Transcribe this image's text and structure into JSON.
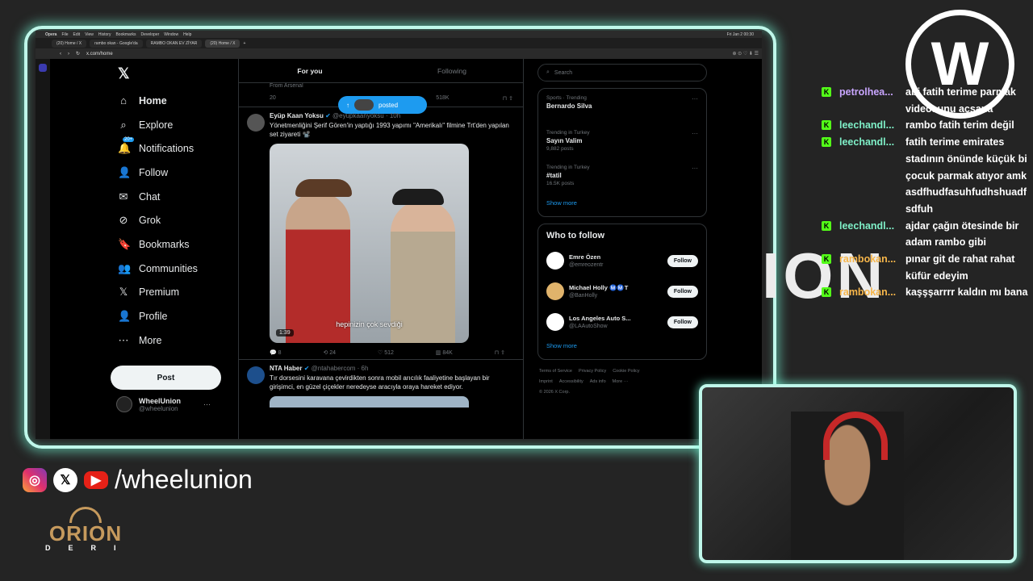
{
  "mac_menu": {
    "app": "Opera",
    "items": [
      "File",
      "Edit",
      "View",
      "History",
      "Bookmarks",
      "Developer",
      "Window",
      "Help"
    ],
    "clock": "Fri Jan 2 00:30"
  },
  "browser": {
    "tabs": [
      "(20) Home / X",
      "rambo okan - Google'da",
      "RAMBO OKAN EV ZİYAR",
      "(20) Home / X"
    ],
    "url": "x.com/home"
  },
  "nav": {
    "home": "Home",
    "explore": "Explore",
    "notifications": "Notifications",
    "notif_badge": "20+",
    "follow": "Follow",
    "chat": "Chat",
    "grok": "Grok",
    "bookmarks": "Bookmarks",
    "communities": "Communities",
    "premium": "Premium",
    "profile": "Profile",
    "more": "More",
    "post": "Post"
  },
  "account": {
    "name": "WheelUnion",
    "handle": "@wheelunion"
  },
  "feed": {
    "tab_for_you": "For you",
    "tab_following": "Following",
    "partial_text": "From Arsenal",
    "partial_replies": "20",
    "partial_views": "518K",
    "posted_pill": "posted",
    "tweet1": {
      "name": "Eyüp Kaan Yoksu",
      "handle": "@eyupkaanyoksu · 10h",
      "text": "Yönetmenliğini Şerif Gören'in yaptığı 1993 yapımı \"Amerikalı\" filmine Trt'den yapılan set ziyareti 📽️",
      "subtitle": "hepinizin çok sevdiği",
      "duration": "1:39",
      "replies": "8",
      "reposts": "24",
      "likes": "512",
      "views": "84K"
    },
    "tweet2": {
      "name": "NTA Haber",
      "handle": "@ntahabercom · 6h",
      "text": "Tır dorsesini karavana çevirdikten sonra mobil arıcılık faaliyetine başlayan bir girişimci, en güzel çiçekler neredeyse aracıyla oraya hareket ediyor."
    }
  },
  "right": {
    "search_placeholder": "Search",
    "trends": [
      {
        "meta": "Sports · Trending",
        "name": "Bernardo Silva",
        "count": ""
      },
      {
        "meta": "Trending in Turkey",
        "name": "Sayın Valim",
        "count": "9,882 posts"
      },
      {
        "meta": "Trending in Turkey",
        "name": "#tatil",
        "count": "16.5K posts"
      }
    ],
    "show_more": "Show more",
    "wtf_title": "Who to follow",
    "follows": [
      {
        "name": "Emre Özen",
        "handle": "@emreozentr",
        "btn": "Follow"
      },
      {
        "name": "Michael Holly Ⓜ️Ⓜ️T",
        "handle": "@BanHolly",
        "btn": "Follow"
      },
      {
        "name": "Los Angeles Auto S...",
        "handle": "@LAAutoShow",
        "btn": "Follow"
      }
    ],
    "show_more2": "Show more",
    "footer": [
      "Terms of Service",
      "Privacy Policy",
      "Cookie Policy",
      "Imprint",
      "Accessibility",
      "Ads info",
      "More ···",
      "© 2026 X Corp."
    ]
  },
  "chat": [
    {
      "user": "petrolhea...",
      "msg": "abi fatih terime parmak videosunu açsana"
    },
    {
      "user": "leechandl...",
      "msg": "rambo fatih terim değil"
    },
    {
      "user": "leechandl...",
      "msg": "fatih terime emirates stadının önünde küçük bi çocuk parmak atıyor amk asdfhudfasuhfudhshuadf sdfuh"
    },
    {
      "user": "leechandl...",
      "msg": "ajdar çağın ötesinde bir adam rambo gibi"
    },
    {
      "user": "rambokan...",
      "msg": "pınar git de rahat rahat küfür edeyim"
    },
    {
      "user": "rambokan...",
      "msg": "kaşşşarrrr kaldın mı bana"
    }
  ],
  "overlay": {
    "logo_letter": "W",
    "big_text": "ION",
    "social_handle": "/wheelunion",
    "sponsor": "ORION",
    "sponsor_sub": "DERI"
  },
  "colors": {
    "accent": "#1d9bf0",
    "glow": "#bff7ea",
    "kick": "#53fc18"
  }
}
